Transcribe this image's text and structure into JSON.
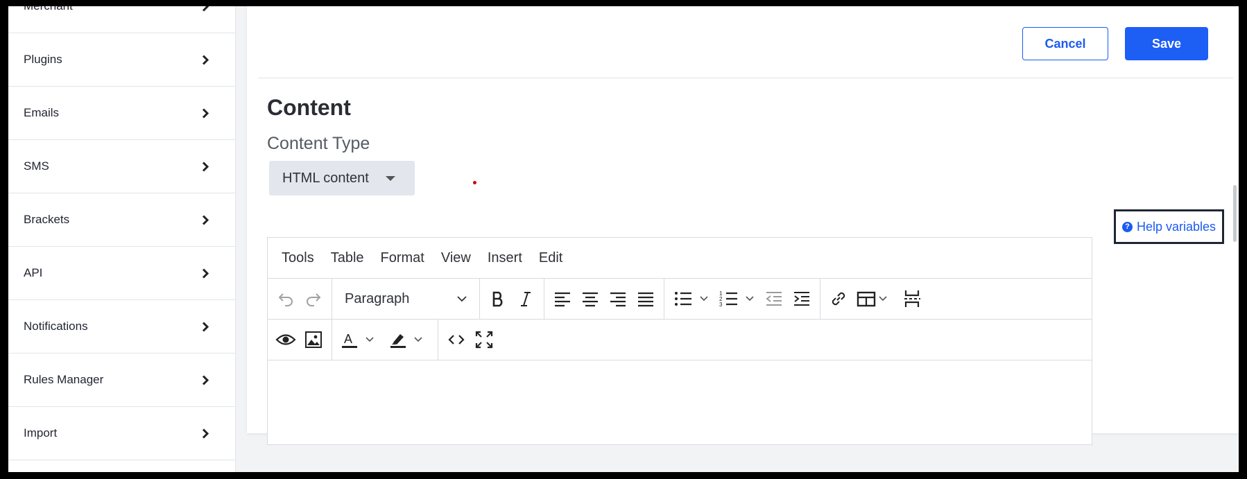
{
  "sidebar": {
    "items": [
      {
        "label": "Merchant",
        "icon": "chevron-right-icon"
      },
      {
        "label": "Plugins",
        "icon": "chevron-right-icon"
      },
      {
        "label": "Emails",
        "icon": "chevron-right-icon"
      },
      {
        "label": "SMS",
        "icon": "chevron-right-icon"
      },
      {
        "label": "Brackets",
        "icon": "chevron-right-icon"
      },
      {
        "label": "API",
        "icon": "chevron-right-icon"
      },
      {
        "label": "Notifications",
        "icon": "chevron-right-icon"
      },
      {
        "label": "Rules Manager",
        "icon": "chevron-right-icon"
      },
      {
        "label": "Import",
        "icon": "chevron-right-icon"
      }
    ]
  },
  "actions": {
    "cancel_label": "Cancel",
    "save_label": "Save"
  },
  "content": {
    "heading": "Content",
    "type_label": "Content Type",
    "type_value": "HTML content"
  },
  "help": {
    "label": "Help variables",
    "icon": "question-circle-icon"
  },
  "editor": {
    "menu": [
      "Tools",
      "Table",
      "Format",
      "View",
      "Insert",
      "Edit"
    ],
    "block_format": "Paragraph",
    "toolbar_icons": [
      "undo-icon",
      "redo-icon",
      "bold-icon",
      "italic-icon",
      "align-left-icon",
      "align-center-icon",
      "align-right-icon",
      "align-justify-icon",
      "bullet-list-icon",
      "numbered-list-icon",
      "outdent-icon",
      "indent-icon",
      "link-icon",
      "table-icon",
      "page-break-icon",
      "preview-icon",
      "image-icon",
      "text-color-icon",
      "highlight-color-icon",
      "source-code-icon",
      "fullscreen-icon"
    ]
  },
  "colors": {
    "accent": "#1d5ef5",
    "sidebar_bg": "#ffffff",
    "page_bg": "#f2f3f5"
  }
}
